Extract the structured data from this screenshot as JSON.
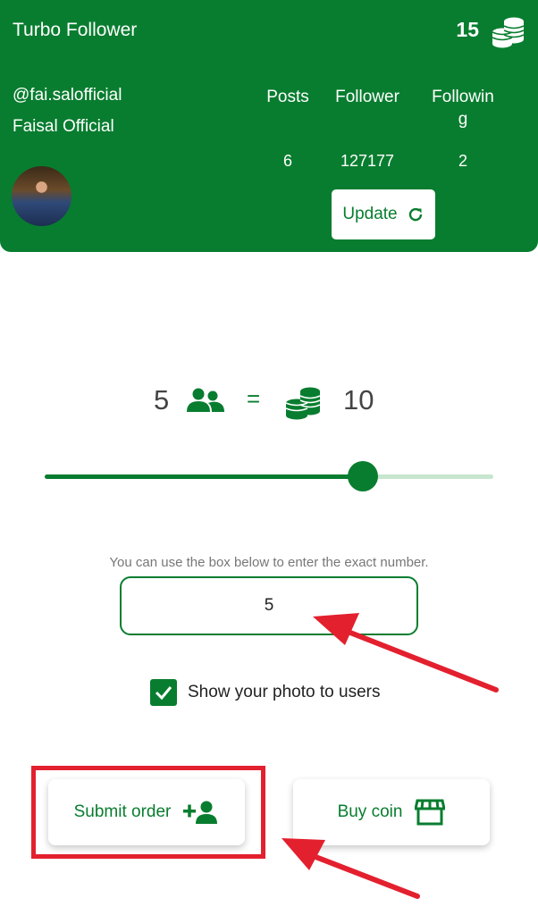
{
  "header": {
    "app_title": "Turbo Follower",
    "coin_count": "15",
    "username": "@fai.salofficial",
    "full_name": "Faisal Official",
    "stats": [
      {
        "label": "Posts",
        "value": "6"
      },
      {
        "label": "Follower",
        "value": "127177"
      },
      {
        "label": "Following",
        "value": "2"
      }
    ],
    "update_label": "Update"
  },
  "rate": {
    "followers": "5",
    "equals": "=",
    "coins": "10"
  },
  "slider": {
    "fraction": 0.71
  },
  "order": {
    "hint": "You can use the box below to enter the exact number.",
    "quantity": "5",
    "show_photo_label": "Show your photo to users",
    "show_photo_checked": true,
    "submit_label": "Submit order",
    "buy_label": "Buy coin"
  },
  "colors": {
    "primary": "#087d2f",
    "annotation": "#e3202e"
  }
}
